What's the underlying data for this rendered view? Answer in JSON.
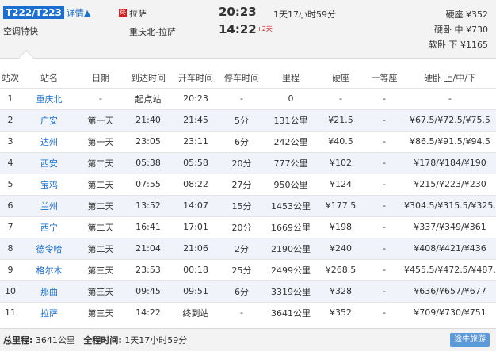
{
  "header": {
    "train_no": "T222/T223",
    "detail_label": "详情▲",
    "train_type": "空调特快",
    "route_icon_label": "终",
    "dest_station": "拉萨",
    "route": "重庆北-拉萨",
    "dep_time": "20:23",
    "arr_time": "14:22",
    "plus_days": "+2天",
    "duration": "1天17小时59分",
    "prices": [
      "硬座 ¥352",
      "硬卧 中 ¥730",
      "软卧 下 ¥1165"
    ]
  },
  "table": {
    "columns": [
      "站次",
      "站名",
      "日期",
      "到达时间",
      "开车时间",
      "停车时间",
      "里程",
      "硬座",
      "一等座",
      "硬卧 上/中/下"
    ],
    "rows": [
      [
        "1",
        "重庆北",
        "-",
        "起点站",
        "20:23",
        "-",
        "0",
        "-",
        "-",
        "-"
      ],
      [
        "2",
        "广安",
        "第一天",
        "21:40",
        "21:45",
        "5分",
        "131公里",
        "¥21.5",
        "-",
        "¥67.5/¥72.5/¥75.5"
      ],
      [
        "3",
        "达州",
        "第一天",
        "23:05",
        "23:11",
        "6分",
        "242公里",
        "¥40.5",
        "-",
        "¥86.5/¥91.5/¥94.5"
      ],
      [
        "4",
        "西安",
        "第二天",
        "05:38",
        "05:58",
        "20分",
        "777公里",
        "¥102",
        "-",
        "¥178/¥184/¥190"
      ],
      [
        "5",
        "宝鸡",
        "第二天",
        "07:55",
        "08:22",
        "27分",
        "950公里",
        "¥124",
        "-",
        "¥215/¥223/¥230"
      ],
      [
        "6",
        "兰州",
        "第二天",
        "13:52",
        "14:07",
        "15分",
        "1453公里",
        "¥177.5",
        "-",
        "¥304.5/¥315.5/¥325.5"
      ],
      [
        "7",
        "西宁",
        "第二天",
        "16:41",
        "17:01",
        "20分",
        "1669公里",
        "¥198",
        "-",
        "¥337/¥349/¥361"
      ],
      [
        "8",
        "德令哈",
        "第二天",
        "21:04",
        "21:06",
        "2分",
        "2190公里",
        "¥240",
        "-",
        "¥408/¥421/¥436"
      ],
      [
        "9",
        "格尔木",
        "第三天",
        "23:53",
        "00:18",
        "25分",
        "2499公里",
        "¥268.5",
        "-",
        "¥455.5/¥472.5/¥487.5"
      ],
      [
        "10",
        "那曲",
        "第三天",
        "09:45",
        "09:51",
        "6分",
        "3319公里",
        "¥328",
        "-",
        "¥636/¥657/¥677"
      ],
      [
        "11",
        "拉萨",
        "第三天",
        "14:22",
        "终到站",
        "-",
        "3641公里",
        "¥352",
        "-",
        "¥709/¥730/¥751"
      ]
    ]
  },
  "footer": {
    "total_km_label": "总里程:",
    "total_km": "3641公里",
    "total_time_label": "全程时间:",
    "total_time": "1天17小时59分"
  },
  "watermark": "途牛旅游"
}
